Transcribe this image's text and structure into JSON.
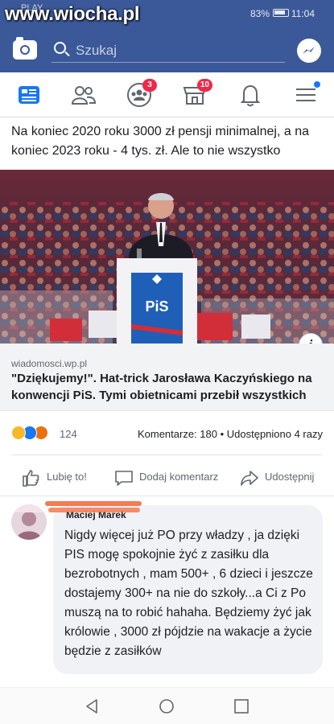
{
  "status_bar": {
    "watermark": "www.wiocha.pl",
    "carrier": "PLAY",
    "battery_percent": "83%",
    "time": "11:04"
  },
  "search": {
    "placeholder": "Szukaj"
  },
  "tabs": {
    "friends_badge": "3",
    "marketplace_badge": "10"
  },
  "post": {
    "text": "Na koniec 2020 roku 3000 zł pensji minimalnej, a na koniec 2023 roku - 4 tys. zł. Ale to nie wszystko",
    "image_podium_label": "PiS",
    "link_domain": "wiadomosci.wp.pl",
    "link_title": "\"Dziękujemy!\". Hat-trick Jarosława Kaczyńskiego na konwencji PiS. Tymi obietnicami przebił wszystkich",
    "reaction_count": "124",
    "stats": "Komentarze: 180 • Udostępniono 4 razy"
  },
  "actions": {
    "like": "Lubię to!",
    "comment": "Dodaj komentarz",
    "share": "Udostępnij"
  },
  "comment": {
    "author": "Maciej Marek",
    "text": "Nigdy więcej już PO przy władzy , ja dzięki PIS mogę spokojnie żyć z zasiłku dla bezrobotnych , mam 500+ , 6 dzieci i jeszcze dostajemy 300+ na nie do szkoły...a Ci z Po muszą na to robić hahaha. Będziemy żyć jak królowie , 3000 zł pójdzie na wakacje a życie będzie z zasiłków"
  },
  "colors": {
    "brand": "#3b5998",
    "badge": "#f02849",
    "accent_blue": "#1877f2"
  }
}
